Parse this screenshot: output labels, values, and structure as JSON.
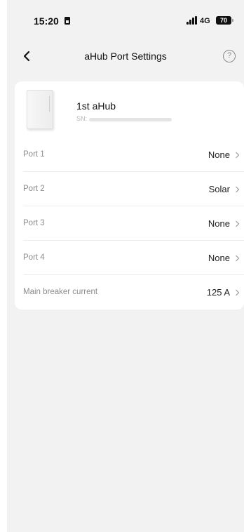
{
  "status_bar": {
    "time": "15:20",
    "network": "4G",
    "battery": "70"
  },
  "header": {
    "title": "aHub Port Settings",
    "help": "?"
  },
  "device": {
    "name": "1st aHub",
    "sn_label": "SN:"
  },
  "rows": [
    {
      "label": "Port 1",
      "value": "None"
    },
    {
      "label": "Port 2",
      "value": "Solar"
    },
    {
      "label": "Port 3",
      "value": "None"
    },
    {
      "label": "Port 4",
      "value": "None"
    },
    {
      "label": "Main breaker current",
      "value": "125 A"
    }
  ],
  "colors": {
    "background": "#f2f2f2",
    "card": "#ffffff",
    "label_text": "#8c8c8c",
    "value_text": "#222222"
  },
  "icons": [
    "sim-icon",
    "signal-icon",
    "battery-icon",
    "back-icon",
    "help-icon",
    "chevron-right-icon"
  ]
}
